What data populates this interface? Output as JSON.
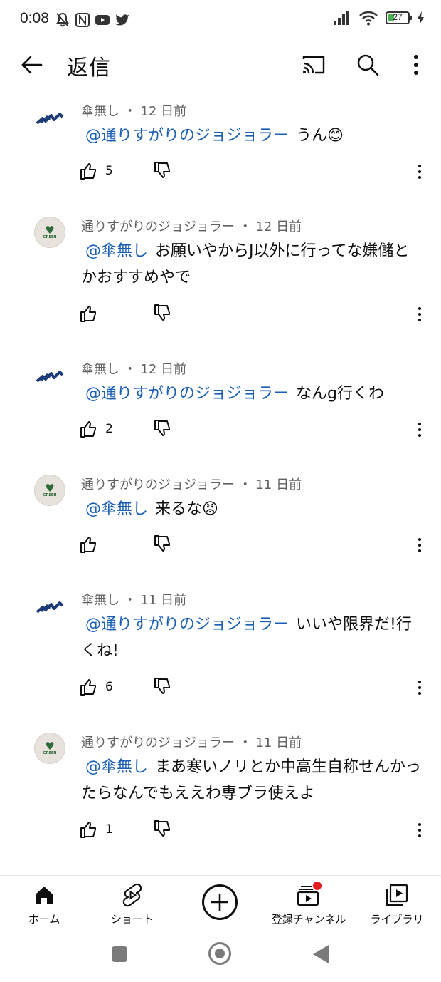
{
  "status_bar": {
    "time": "0:08",
    "battery_level": "27",
    "icons": [
      "muted-bell-icon",
      "nfc-icon",
      "youtube-icon",
      "twitter-icon",
      "signal-icon",
      "wifi-icon",
      "battery-icon",
      "charging-icon"
    ]
  },
  "header": {
    "title": "返信",
    "icons": [
      "back-arrow-icon",
      "cast-icon",
      "search-icon",
      "more-vert-icon"
    ]
  },
  "comments": [
    {
      "author": "傘無し",
      "separator": "・",
      "time": "12 日前",
      "mention": "@通りすがりのジョジョラー",
      "text": "うん😊",
      "likes": "5"
    },
    {
      "author": "通りすがりのジョジョラー",
      "separator": "・",
      "time": "12 日前",
      "mention": "@傘無し",
      "text": "お願いやからJ以外に行ってな嫌儲とかおすすめやで",
      "likes": ""
    },
    {
      "author": "傘無し",
      "separator": "・",
      "time": "12 日前",
      "mention": "@通りすがりのジョジョラー",
      "text": "なんg行くわ",
      "likes": "2"
    },
    {
      "author": "通りすがりのジョジョラー",
      "separator": "・",
      "time": "11 日前",
      "mention": "@傘無し",
      "text": "来るな😡",
      "likes": ""
    },
    {
      "author": "傘無し",
      "separator": "・",
      "time": "11 日前",
      "mention": "@通りすがりのジョジョラー",
      "text": "いいや限界だ!行くね!",
      "likes": "6"
    },
    {
      "author": "通りすがりのジョジョラー",
      "separator": "・",
      "time": "11 日前",
      "mention": "@傘無し",
      "text": "まあ寒いノリとか中高生自称せんかったらなんでもええわ専ブラ使えよ",
      "likes": "1"
    }
  ],
  "bottom_nav": {
    "items": [
      {
        "label": "ホーム",
        "icon": "home-icon"
      },
      {
        "label": "ショート",
        "icon": "shorts-icon"
      },
      {
        "label": "",
        "icon": "create-plus-icon"
      },
      {
        "label": "登録チャンネル",
        "icon": "subscriptions-icon"
      },
      {
        "label": "ライブラリ",
        "icon": "library-icon"
      }
    ]
  },
  "colors": {
    "mention": "#1a5fb4",
    "meta": "#606060",
    "text": "#0f0f0f",
    "notification": "#e51c23",
    "avatar_green": "#2f6b3a"
  }
}
